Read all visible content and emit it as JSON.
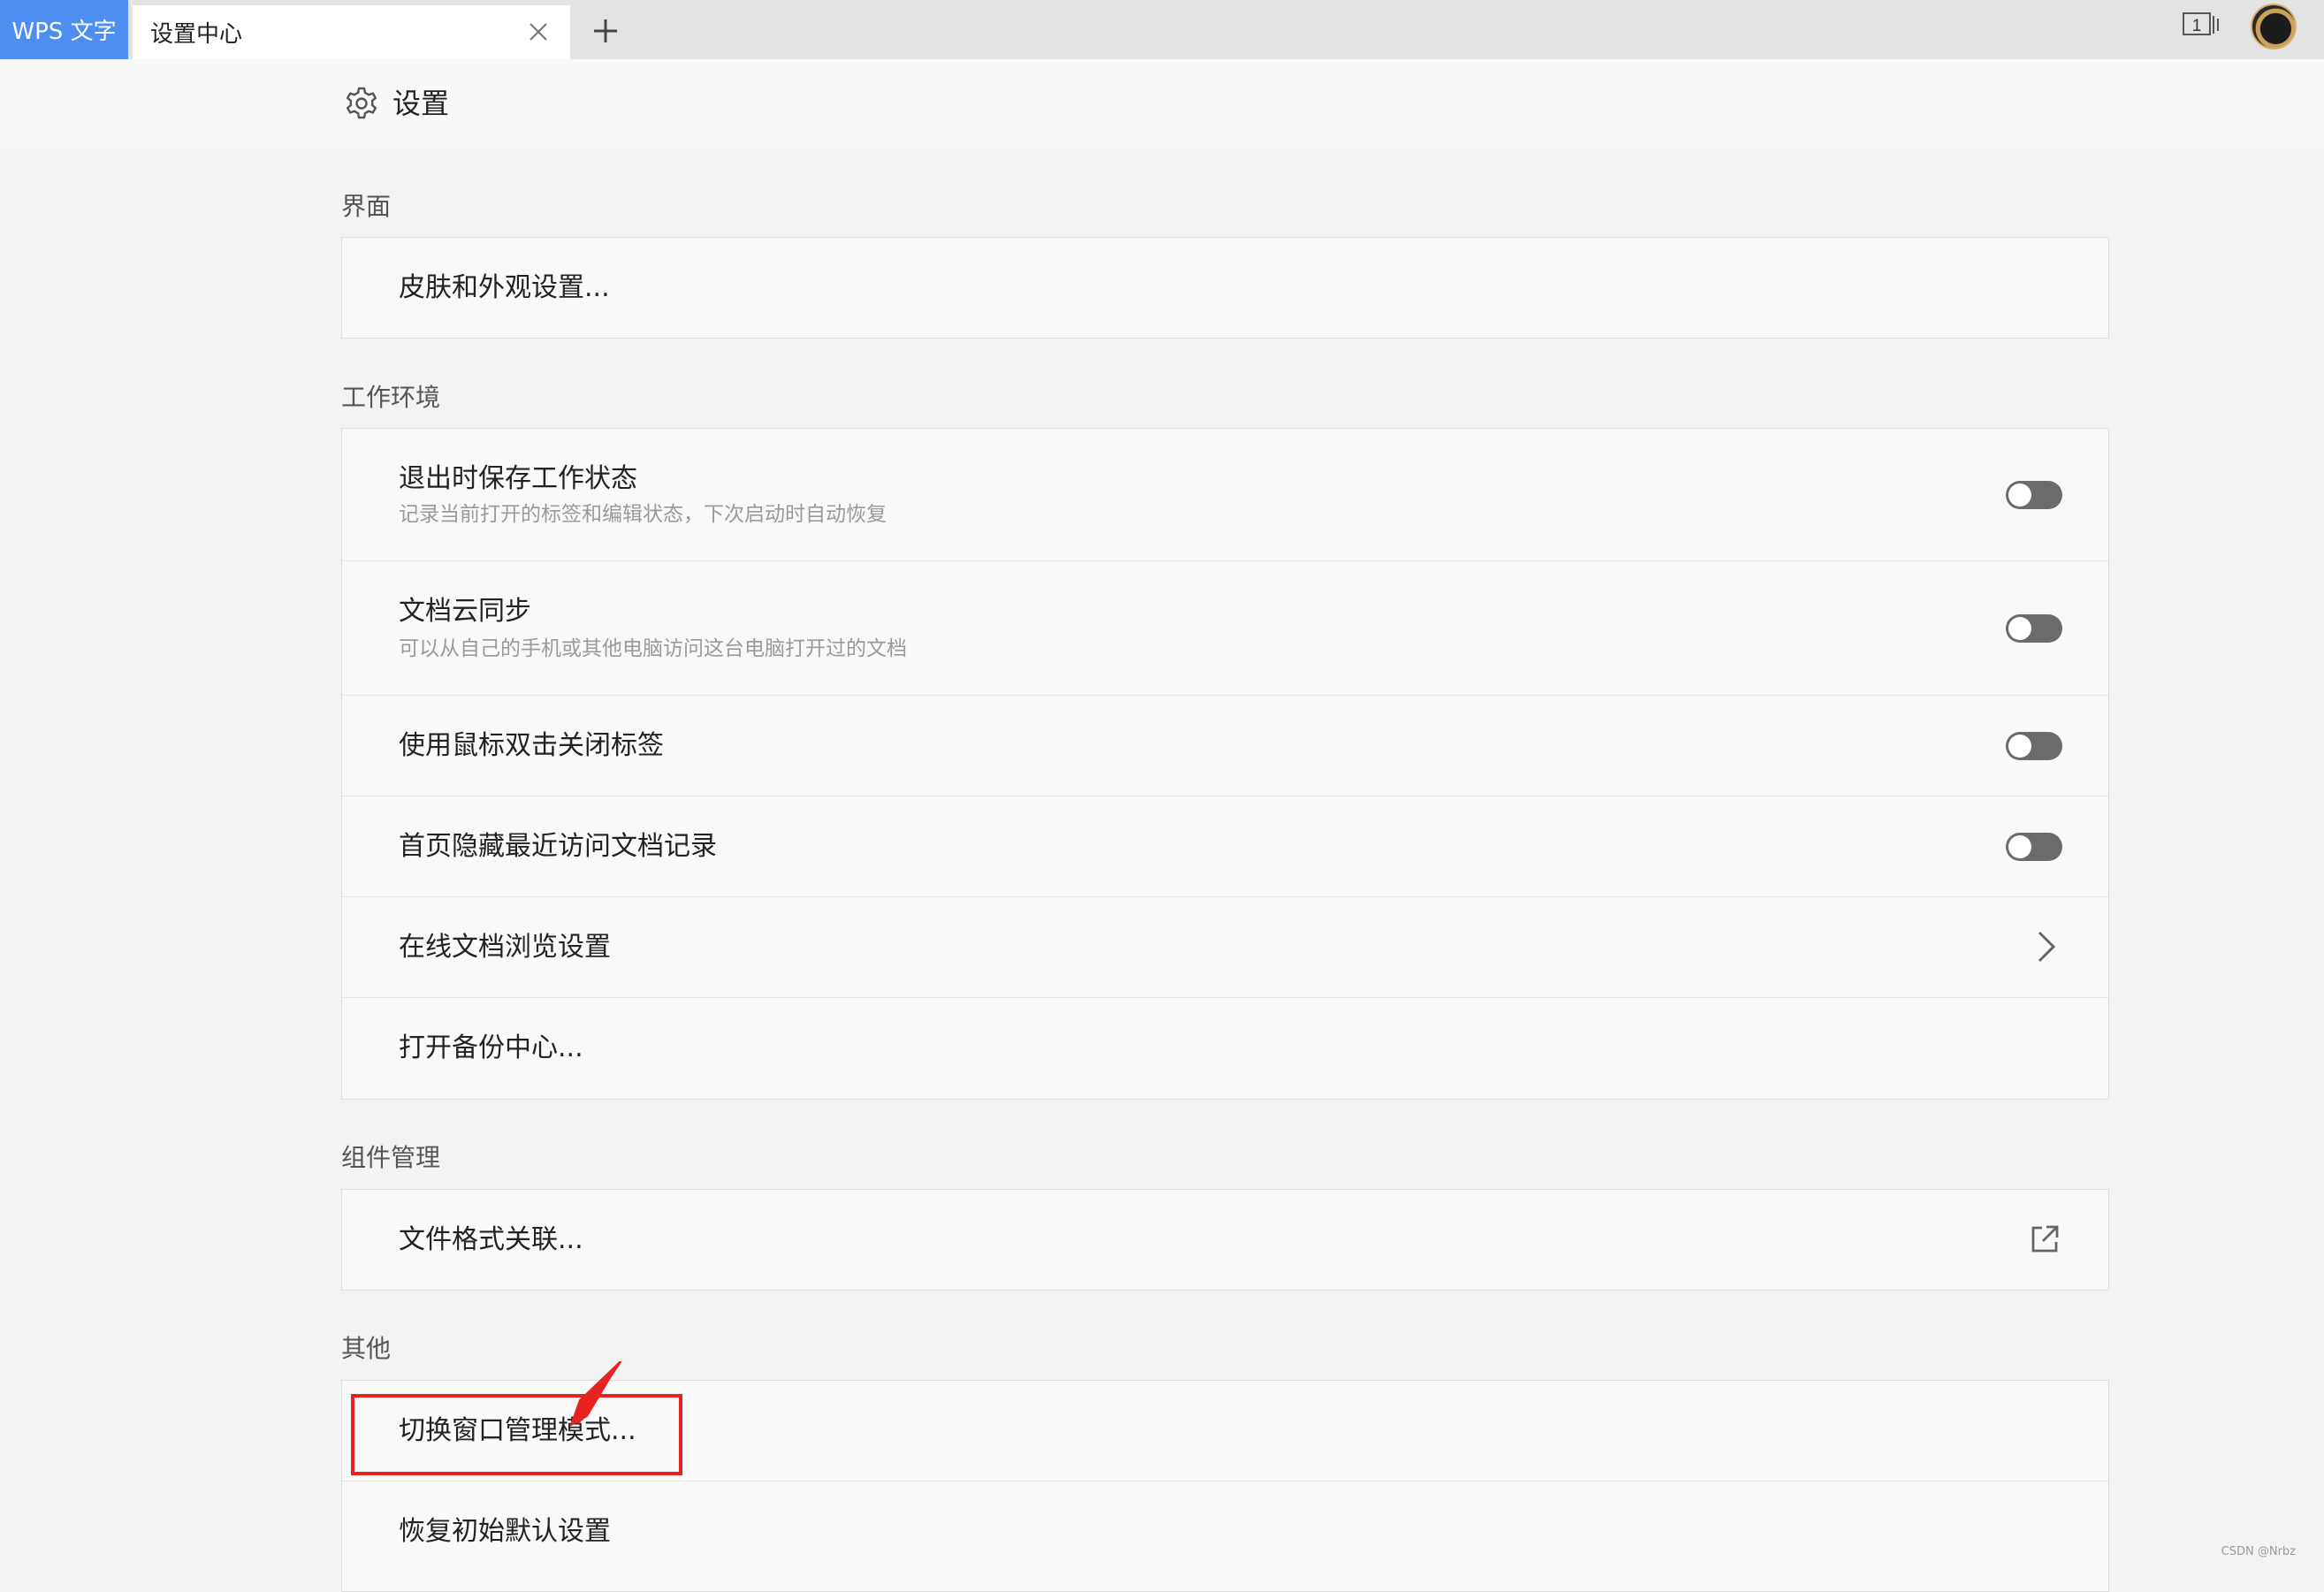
{
  "tabbar": {
    "app_tab": "WPS 文字",
    "active_tab": "设置中心",
    "close_icon": "close-icon",
    "new_tab_icon": "plus-icon",
    "window_indicator": "1"
  },
  "header": {
    "icon": "gear-icon",
    "title": "设置"
  },
  "sections": {
    "interface": {
      "title": "界面",
      "items": [
        {
          "label": "皮肤和外观设置..."
        }
      ]
    },
    "workspace": {
      "title": "工作环境",
      "items": [
        {
          "label": "退出时保存工作状态",
          "desc": "记录当前打开的标签和编辑状态，下次启动时自动恢复",
          "control": "toggle",
          "on": false
        },
        {
          "label": "文档云同步",
          "desc": "可以从自己的手机或其他电脑访问这台电脑打开过的文档",
          "control": "toggle",
          "on": false
        },
        {
          "label": "使用鼠标双击关闭标签",
          "control": "toggle",
          "on": false
        },
        {
          "label": "首页隐藏最近访问文档记录",
          "control": "toggle",
          "on": false
        },
        {
          "label": "在线文档浏览设置",
          "control": "chevron-right-icon"
        },
        {
          "label": "打开备份中心..."
        }
      ]
    },
    "components": {
      "title": "组件管理",
      "items": [
        {
          "label": "文件格式关联...",
          "control": "external-link-icon"
        }
      ]
    },
    "other": {
      "title": "其他",
      "items": [
        {
          "label": "切换窗口管理模式..."
        },
        {
          "label": "恢复初始默认设置"
        }
      ]
    }
  },
  "annotation": {
    "highlight_color": "#e8231f"
  },
  "watermark": "CSDN @Nrbz",
  "colors": {
    "app_tab_bg": "#4e8ef1",
    "toggle_off": "#6b6b6b"
  }
}
